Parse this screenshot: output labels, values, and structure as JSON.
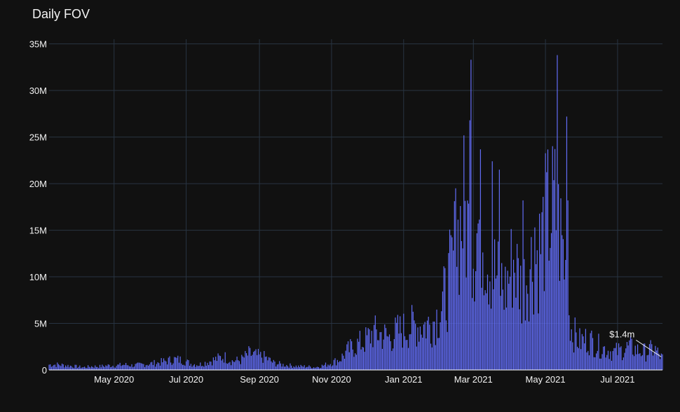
{
  "chart_data": {
    "type": "bar",
    "title": "Daily FOV",
    "xlabel": "",
    "ylabel": "",
    "x_range": [
      "2020-03-07",
      "2021-08-08"
    ],
    "ylim": [
      0,
      35500000
    ],
    "y_ticks": [
      {
        "value": 0,
        "label": "0"
      },
      {
        "value": 5000000,
        "label": "5M"
      },
      {
        "value": 10000000,
        "label": "10M"
      },
      {
        "value": 15000000,
        "label": "15M"
      },
      {
        "value": 20000000,
        "label": "20M"
      },
      {
        "value": 25000000,
        "label": "25M"
      },
      {
        "value": 30000000,
        "label": "30M"
      },
      {
        "value": 35000000,
        "label": "35M"
      }
    ],
    "x_ticks": [
      {
        "date": "2020-05-01",
        "label": "May 2020"
      },
      {
        "date": "2020-07-01",
        "label": "Jul 2020"
      },
      {
        "date": "2020-09-01",
        "label": "Sep 2020"
      },
      {
        "date": "2020-11-01",
        "label": "Nov 2020"
      },
      {
        "date": "2021-01-01",
        "label": "Jan 2021"
      },
      {
        "date": "2021-03-01",
        "label": "Mar 2021"
      },
      {
        "date": "2021-05-01",
        "label": "May 2021"
      },
      {
        "date": "2021-07-01",
        "label": "Jul 2021"
      }
    ],
    "grid": true,
    "legend": "none",
    "bar_color": "#636efa",
    "background": "#111111",
    "grid_color": "#283442",
    "annotation": {
      "text": "$1.4m",
      "date": "2021-08-07",
      "value": 1400000
    },
    "points": [
      [
        "2020-03-07",
        0.6
      ],
      [
        "2020-03-15",
        0.6
      ],
      [
        "2020-03-22",
        0.5
      ],
      [
        "2020-03-29",
        0.4
      ],
      [
        "2020-04-05",
        0.3
      ],
      [
        "2020-04-12",
        0.4
      ],
      [
        "2020-04-19",
        0.4
      ],
      [
        "2020-04-26",
        0.5
      ],
      [
        "2020-05-03",
        0.5
      ],
      [
        "2020-05-10",
        0.6
      ],
      [
        "2020-05-17",
        0.5
      ],
      [
        "2020-05-24",
        0.6
      ],
      [
        "2020-05-31",
        0.7
      ],
      [
        "2020-06-07",
        0.8
      ],
      [
        "2020-06-14",
        1.0
      ],
      [
        "2020-06-21",
        1.2
      ],
      [
        "2020-06-28",
        1.1
      ],
      [
        "2020-07-05",
        0.7
      ],
      [
        "2020-07-12",
        0.6
      ],
      [
        "2020-07-19",
        0.9
      ],
      [
        "2020-07-26",
        1.2
      ],
      [
        "2020-08-02",
        1.5
      ],
      [
        "2020-08-09",
        1.0
      ],
      [
        "2020-08-16",
        1.1
      ],
      [
        "2020-08-23",
        1.8
      ],
      [
        "2020-08-30",
        1.6
      ],
      [
        "2020-09-06",
        1.4
      ],
      [
        "2020-09-13",
        0.8
      ],
      [
        "2020-09-20",
        0.6
      ],
      [
        "2020-09-27",
        0.5
      ],
      [
        "2020-10-04",
        0.4
      ],
      [
        "2020-10-11",
        0.4
      ],
      [
        "2020-10-18",
        0.3
      ],
      [
        "2020-10-25",
        0.5
      ],
      [
        "2020-11-01",
        0.8
      ],
      [
        "2020-11-08",
        1.2
      ],
      [
        "2020-11-15",
        2.2
      ],
      [
        "2020-11-22",
        2.8
      ],
      [
        "2020-11-29",
        3.2
      ],
      [
        "2020-12-06",
        4.2
      ],
      [
        "2020-12-13",
        4.0
      ],
      [
        "2020-12-20",
        3.6
      ],
      [
        "2020-12-27",
        4.3
      ],
      [
        "2021-01-03",
        4.6
      ],
      [
        "2021-01-10",
        5.0
      ],
      [
        "2021-01-17",
        5.0
      ],
      [
        "2021-01-24",
        5.2
      ],
      [
        "2021-01-31",
        6.4
      ],
      [
        "2021-02-07",
        9.0
      ],
      [
        "2021-02-14",
        14.0
      ],
      [
        "2021-02-21",
        18.0
      ],
      [
        "2021-02-28",
        13.5
      ],
      [
        "2021-03-07",
        17.0
      ],
      [
        "2021-03-14",
        12.5
      ],
      [
        "2021-03-21",
        10.5
      ],
      [
        "2021-03-28",
        9.0
      ],
      [
        "2021-04-04",
        12.5
      ],
      [
        "2021-04-11",
        9.0
      ],
      [
        "2021-04-18",
        12.0
      ],
      [
        "2021-04-25",
        13.0
      ],
      [
        "2021-05-02",
        17.0
      ],
      [
        "2021-05-09",
        18.0
      ],
      [
        "2021-05-16",
        13.5
      ],
      [
        "2021-05-23",
        4.5
      ],
      [
        "2021-05-30",
        3.2
      ],
      [
        "2021-06-06",
        3.5
      ],
      [
        "2021-06-13",
        2.8
      ],
      [
        "2021-06-20",
        2.4
      ],
      [
        "2021-06-27",
        2.0
      ],
      [
        "2021-07-04",
        2.2
      ],
      [
        "2021-07-11",
        2.6
      ],
      [
        "2021-07-18",
        2.2
      ],
      [
        "2021-07-25",
        2.0
      ],
      [
        "2021-08-01",
        2.4
      ],
      [
        "2021-08-07",
        1.4
      ]
    ],
    "spikes": [
      [
        "2021-02-26",
        26.8
      ],
      [
        "2021-02-27",
        33.3
      ],
      [
        "2021-03-17",
        22.4
      ],
      [
        "2021-03-23",
        21.5
      ],
      [
        "2021-04-12",
        18.2
      ],
      [
        "2021-05-11",
        33.8
      ],
      [
        "2021-05-19",
        27.2
      ],
      [
        "2021-05-20",
        18.2
      ],
      [
        "2021-02-14",
        19.5
      ],
      [
        "2021-04-22",
        15.3
      ]
    ]
  }
}
